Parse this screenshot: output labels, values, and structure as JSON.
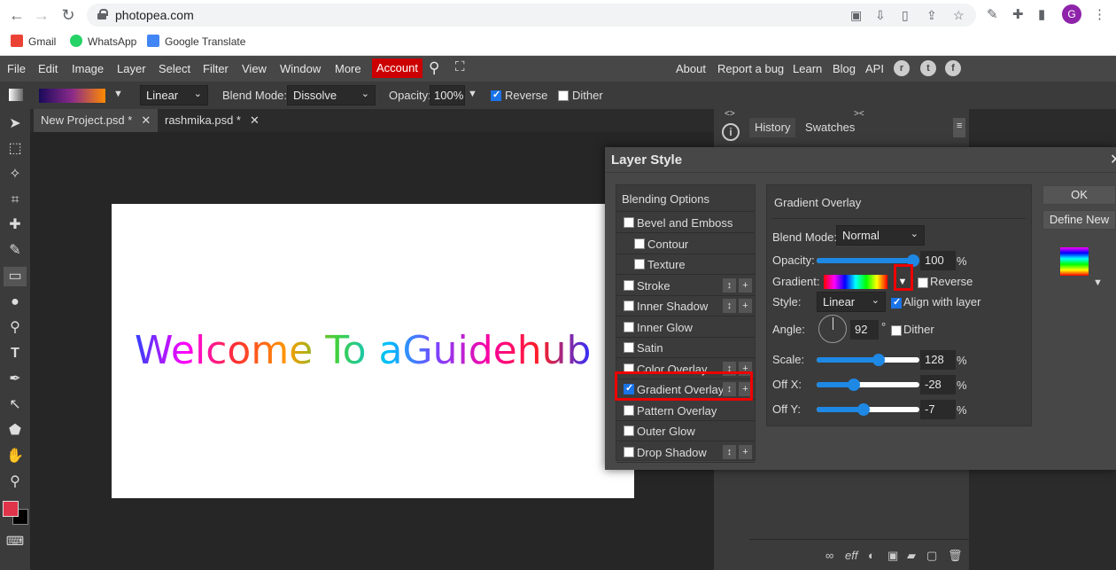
{
  "browser": {
    "url": "photopea.com",
    "avatar_letter": "G",
    "bookmarks": [
      "Gmail",
      "WhatsApp",
      "Google Translate"
    ]
  },
  "menu": {
    "items": [
      "File",
      "Edit",
      "Image",
      "Layer",
      "Select",
      "Filter",
      "View",
      "Window",
      "More"
    ],
    "account": "Account",
    "right_links": [
      "About",
      "Report a bug",
      "Learn",
      "Blog",
      "API"
    ]
  },
  "options": {
    "gradient_type": "Linear",
    "blend_label": "Blend Mode:",
    "blend_value": "Dissolve",
    "opacity_label": "Opacity:",
    "opacity_value": "100%",
    "reverse_label": "Reverse",
    "reverse_checked": true,
    "dither_label": "Dither",
    "dither_checked": false
  },
  "tabs": [
    {
      "label": "New Project.psd *",
      "close": "✕"
    },
    {
      "label": "rashmika.psd *",
      "close": "✕"
    }
  ],
  "canvas": {
    "text": "Welcome To aGuidehub"
  },
  "right_panel": {
    "tabs": [
      "History",
      "Swatches"
    ],
    "menu_icon": "≡"
  },
  "layer_style": {
    "title": "Layer Style",
    "close": "✕",
    "list_header": "Blending Options",
    "styles": [
      {
        "label": "Bevel and Emboss",
        "checked": false,
        "indent": false,
        "buttons": false
      },
      {
        "label": "Contour",
        "checked": false,
        "indent": true,
        "buttons": false
      },
      {
        "label": "Texture",
        "checked": false,
        "indent": true,
        "buttons": false
      },
      {
        "label": "Stroke",
        "checked": false,
        "indent": false,
        "buttons": true
      },
      {
        "label": "Inner Shadow",
        "checked": false,
        "indent": false,
        "buttons": true
      },
      {
        "label": "Inner Glow",
        "checked": false,
        "indent": false,
        "buttons": false
      },
      {
        "label": "Satin",
        "checked": false,
        "indent": false,
        "buttons": false
      },
      {
        "label": "Color Overlay",
        "checked": false,
        "indent": false,
        "buttons": true
      },
      {
        "label": "Gradient Overlay",
        "checked": true,
        "indent": false,
        "buttons": true
      },
      {
        "label": "Pattern Overlay",
        "checked": false,
        "indent": false,
        "buttons": false
      },
      {
        "label": "Outer Glow",
        "checked": false,
        "indent": false,
        "buttons": false
      },
      {
        "label": "Drop Shadow",
        "checked": false,
        "indent": false,
        "buttons": true
      }
    ],
    "gradient_overlay": {
      "title": "Gradient Overlay",
      "blend_label": "Blend Mode:",
      "blend_value": "Normal",
      "opacity_label": "Opacity:",
      "opacity_value": "100",
      "opacity_level": 1.0,
      "gradient_label": "Gradient:",
      "reverse_label": "Reverse",
      "reverse_checked": false,
      "style_label": "Style:",
      "style_value": "Linear",
      "align_label": "Align with layer",
      "align_checked": true,
      "angle_label": "Angle:",
      "angle_value": "92",
      "angle_unit": "°",
      "dither_label": "Dither",
      "dither_checked": false,
      "scale_label": "Scale:",
      "scale_value": "128",
      "scale_level": 0.6,
      "offx_label": "Off X:",
      "offx_value": "-28",
      "offx_level": 0.36,
      "offy_label": "Off Y:",
      "offy_value": "-7",
      "offy_level": 0.46,
      "percent": "%"
    },
    "ok_label": "OK",
    "define_new_label": "Define New"
  },
  "colors": {
    "accent_blue": "#1e88e5",
    "account_red": "#cc0000",
    "foreground_color": "#e0344a",
    "background_color": "#000000"
  }
}
